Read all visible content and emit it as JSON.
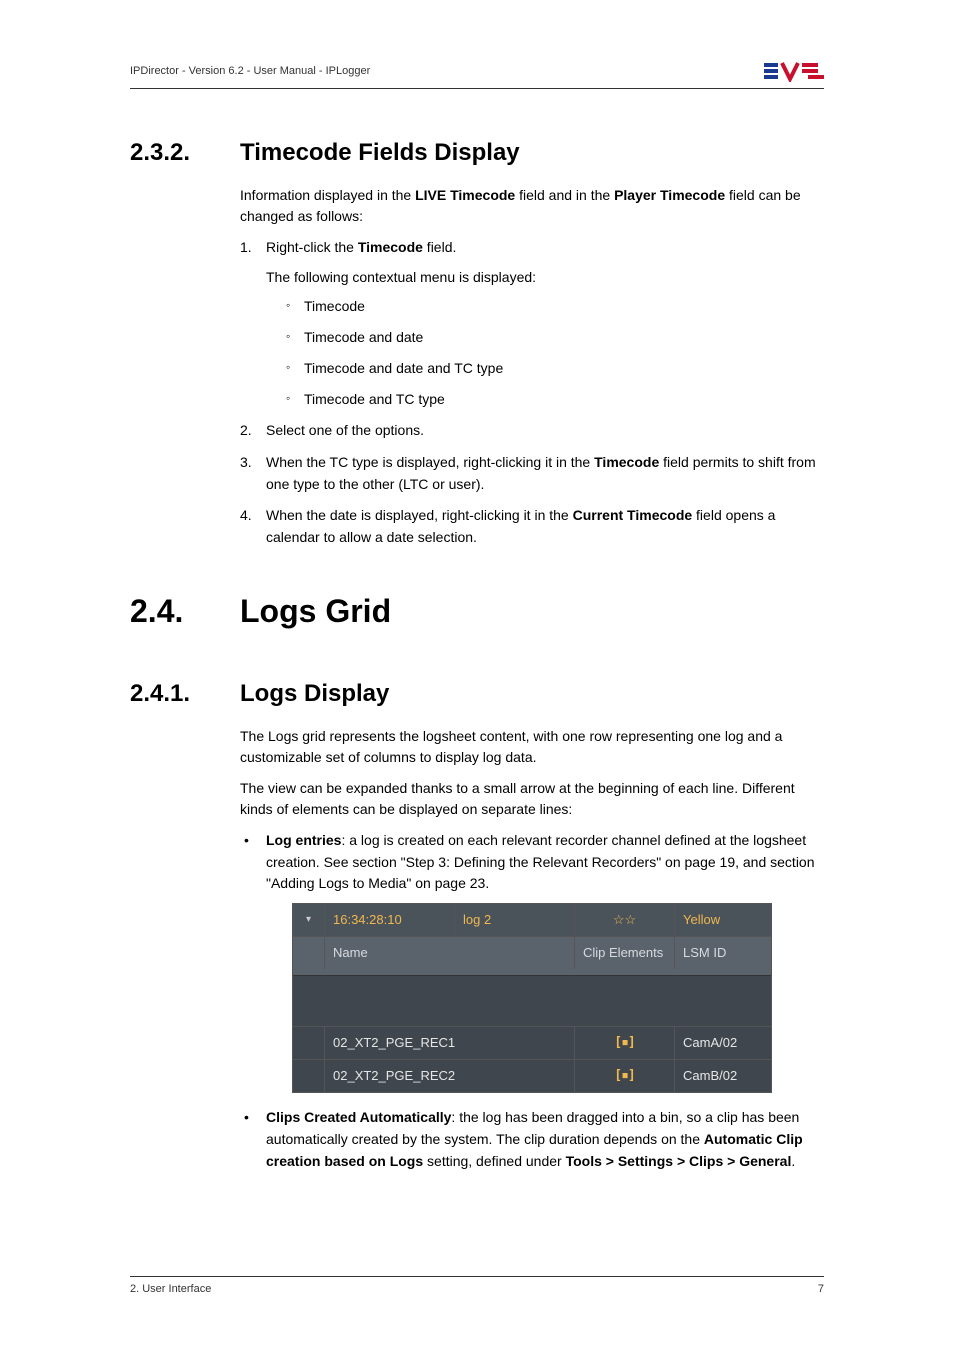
{
  "header": {
    "text": "IPDirector - Version 6.2 - User Manual - IPLogger"
  },
  "s232": {
    "num": "2.3.2.",
    "title": "Timecode Fields Display",
    "intro_a": "Information displayed in the ",
    "intro_b": "LIVE Timecode",
    "intro_c": " field and in the ",
    "intro_d": "Player Timecode",
    "intro_e": " field can be changed as follows:",
    "step1_a": "Right-click the ",
    "step1_b": "Timecode",
    "step1_c": " field.",
    "step1_sub": "The following contextual menu is displayed:",
    "menu": [
      "Timecode",
      "Timecode and date",
      "Timecode and date and TC type",
      "Timecode and TC type"
    ],
    "step2": "Select one of the options.",
    "step3_a": "When the TC type is displayed, right-clicking it in the ",
    "step3_b": "Timecode",
    "step3_c": " field permits to shift from one type to the other (LTC or user).",
    "step4_a": "When the date is displayed, right-clicking it in the ",
    "step4_b": "Current Timecode",
    "step4_c": " field opens a calendar to allow a date selection."
  },
  "s24": {
    "num": "2.4.",
    "title": "Logs Grid"
  },
  "s241": {
    "num": "2.4.1.",
    "title": "Logs Display",
    "p1": "The Logs grid represents the logsheet content, with one row representing one log and a customizable set of columns to display log data.",
    "p2": "The view can be expanded thanks to a small arrow at the beginning of each line. Different kinds of elements can be displayed on separate lines:",
    "bullet1_a": "Log entries",
    "bullet1_b": ": a log is created on each relevant recorder channel defined at the logsheet creation. See section \"Step 3: Defining the Relevant Recorders\" on page 19, and section \"Adding Logs to Media\" on page 23.",
    "bullet2_a": "Clips Created Automatically",
    "bullet2_b": ": the log has been dragged into a bin, so a clip has been automatically created by the system. The clip duration depends on the ",
    "bullet2_c": "Automatic Clip creation based on Logs",
    "bullet2_d": " setting, defined under ",
    "bullet2_e": "Tools > Settings > Clips > General",
    "bullet2_f": "."
  },
  "table": {
    "top": {
      "collapse": "▾",
      "timecode": "16:34:28:10",
      "log": "log 2",
      "stars": "☆☆",
      "color": "Yellow"
    },
    "headers": {
      "name": "Name",
      "elements": "Clip Elements",
      "lsm": "LSM ID"
    },
    "rows": [
      {
        "name": "02_XT2_PGE_REC1",
        "icon": "[▪]",
        "lsm": "CamA/02"
      },
      {
        "name": "02_XT2_PGE_REC2",
        "icon": "[▪]",
        "lsm": "CamB/02"
      }
    ]
  },
  "footer": {
    "left": "2. User Interface",
    "right": "7"
  }
}
